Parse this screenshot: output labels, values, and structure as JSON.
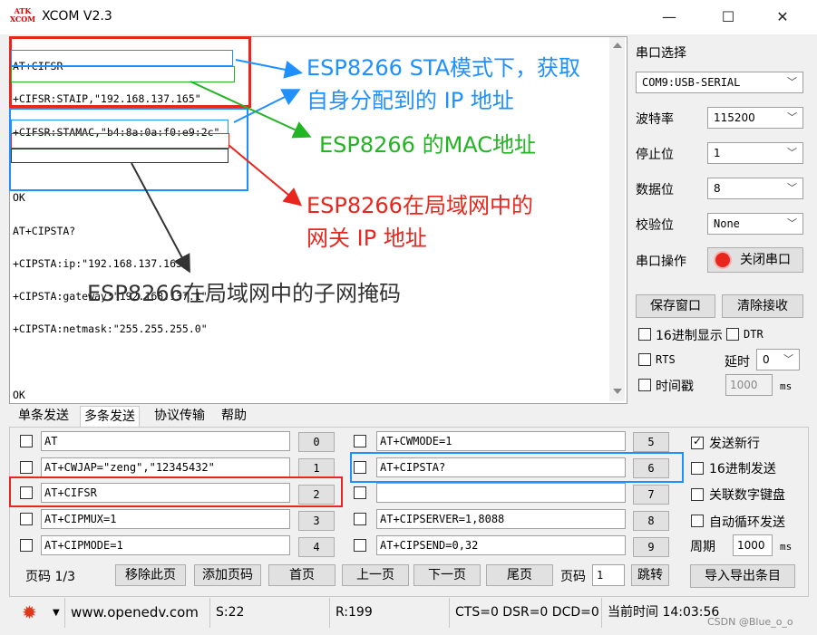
{
  "app": {
    "title": "XCOM V2.3",
    "logo_top": "ATK",
    "logo_bottom": "XCOM"
  },
  "window": {
    "minimize": "—",
    "maximize": "☐",
    "close": "✕"
  },
  "receive": {
    "lines": [
      "AT+CIFSR",
      "+CIFSR:STAIP,\"192.168.137.165\"",
      "+CIFSR:STAMAC,\"b4:8a:0a:f0:e9:2c\"",
      "",
      "OK",
      "AT+CIPSTA?",
      "+CIPSTA:ip:\"192.168.137.165\"",
      "+CIPSTA:gateway:\"192.168.137.1\"",
      "+CIPSTA:netmask:\"255.255.255.0\"",
      "",
      "OK"
    ]
  },
  "annotations": {
    "sta_ip_1": "ESP8266 STA模式下，获取",
    "sta_ip_2": "自身分配到的 IP 地址",
    "mac": "ESP8266 的MAC地址",
    "gateway_1": "ESP8266在局域网中的",
    "gateway_2": "网关 IP 地址",
    "netmask": "ESP8266在局域网中的子网掩码",
    "colors": {
      "blue": "#1e90ff",
      "green": "#22b422",
      "red": "#e8261e",
      "gray": "#333333"
    }
  },
  "right_panel": {
    "serial_select_label": "串口选择",
    "port_value": "COM9:USB-SERIAL",
    "baud_label": "波特率",
    "baud_value": "115200",
    "stopbits_label": "停止位",
    "stopbits_value": "1",
    "databits_label": "数据位",
    "databits_value": "8",
    "parity_label": "校验位",
    "parity_value": "None",
    "port_op_label": "串口操作",
    "close_port_button": "关闭串口",
    "save_window_button": "保存窗口",
    "clear_recv_button": "清除接收",
    "hex_display": "16进制显示",
    "dtr": "DTR",
    "rts": "RTS",
    "delay_label": "延时",
    "delay_value": "0",
    "timestamp": "时间戳",
    "timestamp_value": "1000",
    "ms": "ms"
  },
  "tabs": [
    "单条发送",
    "多条发送",
    "协议传输",
    "帮助"
  ],
  "send_rows_left": [
    {
      "text": "AT",
      "num": "0"
    },
    {
      "text": "AT+CWJAP=\"zeng\",\"12345432\"",
      "num": "1"
    },
    {
      "text": "AT+CIFSR",
      "num": "2"
    },
    {
      "text": "AT+CIPMUX=1",
      "num": "3"
    },
    {
      "text": "AT+CIPMODE=1",
      "num": "4"
    }
  ],
  "send_rows_right": [
    {
      "text": "AT+CWMODE=1",
      "num": "5"
    },
    {
      "text": "AT+CIPSTA?",
      "num": "6"
    },
    {
      "text": "",
      "num": "7"
    },
    {
      "text": "AT+CIPSERVER=1,8088",
      "num": "8"
    },
    {
      "text": "AT+CIPSEND=0,32",
      "num": "9"
    }
  ],
  "send_options": {
    "send_newline": "发送新行",
    "hex_send": "16进制发送",
    "link_numpad": "关联数字键盘",
    "auto_loop": "自动循环发送",
    "period_label": "周期",
    "period_value": "1000",
    "ms": "ms"
  },
  "pager": {
    "page_label": "页码 1/3",
    "remove_page": "移除此页",
    "add_page": "添加页码",
    "first": "首页",
    "prev": "上一页",
    "next": "下一页",
    "last": "尾页",
    "page_input_label": "页码",
    "page_input_value": "1",
    "jump": "跳转",
    "import_export": "导入导出条目"
  },
  "statusbar": {
    "url": "www.openedv.com",
    "sent": "S:22",
    "recv": "R:199",
    "lines": "CTS=0 DSR=0 DCD=0",
    "time": "当前时间 14:03:56"
  },
  "watermark": "CSDN @Blue_o_o"
}
